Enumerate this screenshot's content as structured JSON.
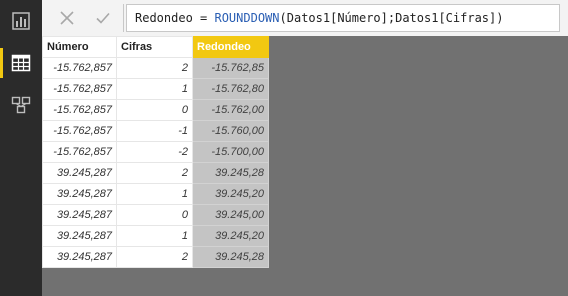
{
  "formula_bar": {
    "text_prefix": "Redondeo = ",
    "text_fn": "ROUNDDOWN",
    "text_args": "(Datos1[Número];Datos1[Cifras])"
  },
  "table": {
    "headers": [
      "Número",
      "Cifras",
      "Redondeo"
    ],
    "rows": [
      [
        "-15.762,857",
        "2",
        "-15.762,85"
      ],
      [
        "-15.762,857",
        "1",
        "-15.762,80"
      ],
      [
        "-15.762,857",
        "0",
        "-15.762,00"
      ],
      [
        "-15.762,857",
        "-1",
        "-15.760,00"
      ],
      [
        "-15.762,857",
        "-2",
        "-15.700,00"
      ],
      [
        "39.245,287",
        "2",
        "39.245,28"
      ],
      [
        "39.245,287",
        "1",
        "39.245,20"
      ],
      [
        "39.245,287",
        "0",
        "39.245,00"
      ],
      [
        "39.245,287",
        "1",
        "39.245,20"
      ],
      [
        "39.245,287",
        "2",
        "39.245,28"
      ]
    ]
  },
  "colors": {
    "accent": "#f2c811",
    "rail": "#2b2b2b",
    "canvas": "#717171",
    "selected_column": "#c4c4c4"
  },
  "icons": {
    "rail": [
      "report-view-icon",
      "data-view-icon",
      "relationships-view-icon"
    ],
    "formula": [
      "cancel-icon",
      "commit-icon"
    ]
  }
}
